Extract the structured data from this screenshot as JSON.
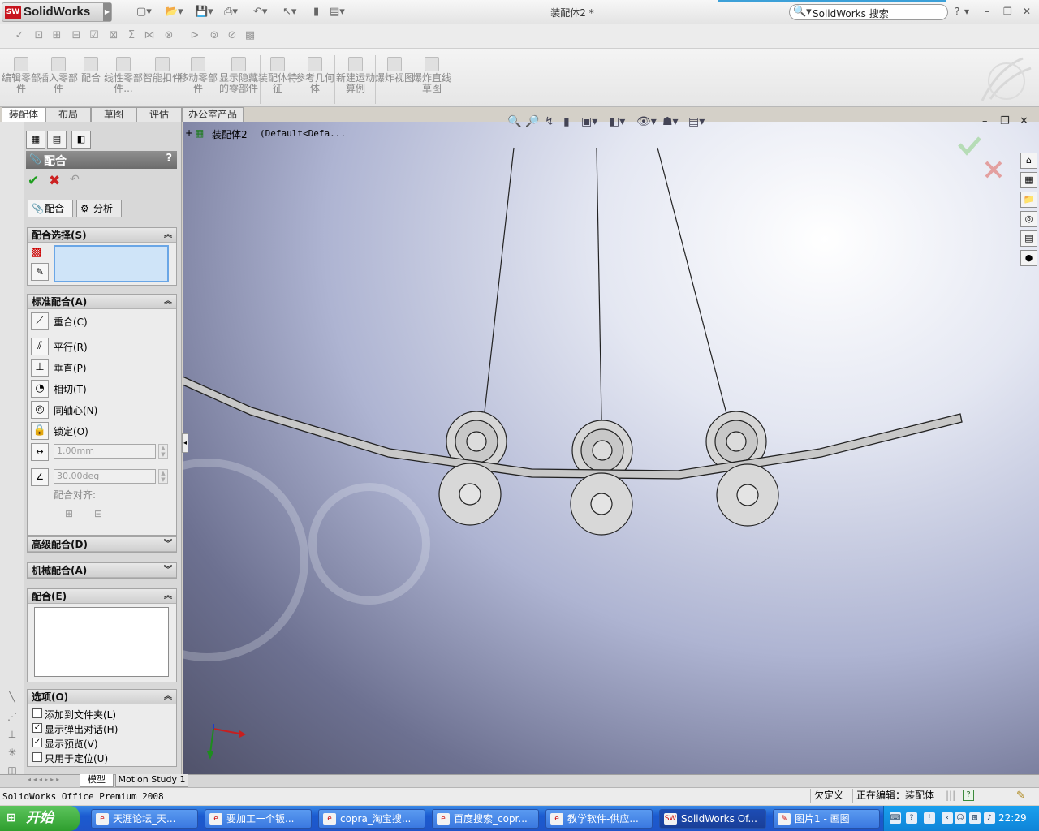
{
  "app": {
    "logo_text": "SolidWorks",
    "logo_badge": "SW",
    "document_title": "装配体2 *",
    "search_placeholder": "SolidWorks 搜索",
    "help_label": "?"
  },
  "command_manager": {
    "items": [
      {
        "label": "编辑零部件"
      },
      {
        "label": "插入零部件"
      },
      {
        "label": "配合"
      },
      {
        "label": "线性零部件..."
      },
      {
        "label": "智能扣件"
      },
      {
        "label": "移动零部件"
      },
      {
        "label": "显示隐藏的零部件"
      },
      {
        "label": "装配体特征"
      },
      {
        "label": "参考几何体"
      },
      {
        "label": "新建运动算例"
      },
      {
        "label": "爆炸视图"
      },
      {
        "label": "爆炸直线草图"
      }
    ]
  },
  "tabs": [
    {
      "label": "装配体"
    },
    {
      "label": "布局"
    },
    {
      "label": "草图"
    },
    {
      "label": "评估"
    },
    {
      "label": "办公室产品"
    }
  ],
  "property_manager": {
    "title": "配合",
    "help": "?",
    "subtabs": [
      {
        "label": "配合"
      },
      {
        "label": "分析"
      }
    ],
    "selection_group": "配合选择(S)",
    "standard_group": "标准配合(A)",
    "standard_mates": [
      {
        "label": "重合(C)"
      },
      {
        "label": "平行(R)"
      },
      {
        "label": "垂直(P)"
      },
      {
        "label": "相切(T)"
      },
      {
        "label": "同轴心(N)"
      },
      {
        "label": "锁定(O)"
      }
    ],
    "distance_value": "1.00mm",
    "angle_value": "30.00deg",
    "alignment_label": "配合对齐:",
    "advanced_group": "高级配合(D)",
    "mechanical_group": "机械配合(A)",
    "mates_group": "配合(E)",
    "options_group": "选项(O)",
    "options": [
      {
        "label": "添加到文件夹(L)",
        "checked": false
      },
      {
        "label": "显示弹出对话(H)",
        "checked": true
      },
      {
        "label": "显示预览(V)",
        "checked": true
      },
      {
        "label": "只用于定位(U)",
        "checked": false
      }
    ]
  },
  "tree": {
    "expander": "+",
    "root_name": "装配体2",
    "root_config": "(Default<Defa..."
  },
  "bottom_tabs": [
    {
      "label": "模型"
    },
    {
      "label": "Motion Study 1"
    }
  ],
  "status_bar": {
    "product": "SolidWorks Office Premium 2008",
    "state": "欠定义",
    "editing": "正在编辑：装配体"
  },
  "taskbar": {
    "start_label": "开始",
    "tasks": [
      {
        "label": "天涯论坛_天..."
      },
      {
        "label": "要加工一个钣..."
      },
      {
        "label": "copra_淘宝搜..."
      },
      {
        "label": "百度搜索_copr..."
      },
      {
        "label": "教学软件-供应..."
      },
      {
        "label": "SolidWorks Of..."
      },
      {
        "label": "图片1 - 画图"
      }
    ],
    "clock": "22:29"
  },
  "colors": {
    "accent_red": "#c8141e",
    "taskbar_blue": "#1f55c8",
    "ok_green": "#1e9e1e",
    "cancel_red": "#cc2222"
  }
}
